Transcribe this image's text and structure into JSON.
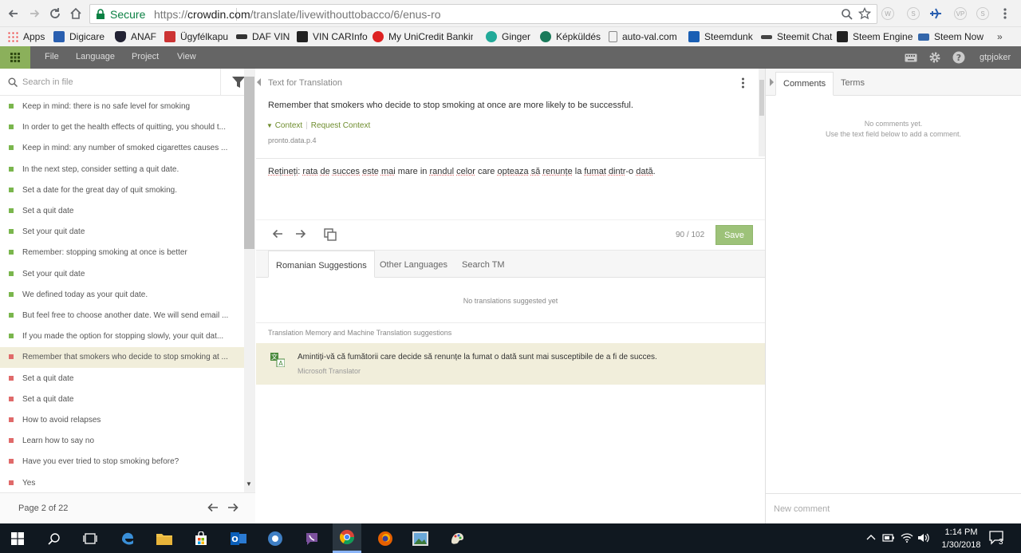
{
  "browser": {
    "secure_label": "Secure",
    "url_scheme": "https://",
    "url_domain": "crowdin.com",
    "url_path": "/translate/livewithouttobacco/6/enus-ro",
    "extensions": [
      "W",
      "S",
      "VP",
      "S"
    ]
  },
  "bookmarks": [
    {
      "label": "Apps",
      "color": "#e44"
    },
    {
      "label": "Digicare",
      "color": "#2a5fb0"
    },
    {
      "label": "ANAF",
      "color": "#223"
    },
    {
      "label": "Ügyfélkapu",
      "color": "#c33"
    },
    {
      "label": "DAF VIN",
      "color": "#333"
    },
    {
      "label": "VIN CARInfo",
      "color": "#222"
    },
    {
      "label": "My UniCredit Banking",
      "color": "#d22"
    },
    {
      "label": "Ginger",
      "color": "#2a9"
    },
    {
      "label": "Képküldés",
      "color": "#1a7a5a"
    },
    {
      "label": "auto-val.com",
      "color": "#888"
    },
    {
      "label": "Steemdunk",
      "color": "#1a5fb4"
    },
    {
      "label": "Steemit Chat",
      "color": "#444"
    },
    {
      "label": "Steem Engine",
      "color": "#222"
    },
    {
      "label": "Steem Now",
      "color": "#3366aa"
    }
  ],
  "bookmarks_more": "»",
  "appbar": {
    "menu": [
      "File",
      "Language",
      "Project",
      "View"
    ],
    "user": "gtpjoker"
  },
  "left": {
    "search_placeholder": "Search in file",
    "strings": [
      {
        "text": "Keep in mind: there is no safe level for smoking",
        "status": "translated"
      },
      {
        "text": "In order to get the health effects of quitting, you should t...",
        "status": "translated"
      },
      {
        "text": "Keep in mind: any number of smoked cigarettes causes ...",
        "status": "translated"
      },
      {
        "text": "In the next step, consider setting a quit date.",
        "status": "translated"
      },
      {
        "text": "Set a date for the great day of quit smoking.",
        "status": "translated"
      },
      {
        "text": "Set a quit date",
        "status": "translated"
      },
      {
        "text": "Set your quit date",
        "status": "translated"
      },
      {
        "text": "Remember: stopping smoking at once is better",
        "status": "translated"
      },
      {
        "text": "Set your quit date",
        "status": "translated"
      },
      {
        "text": "We defined today as your quit date.",
        "status": "translated"
      },
      {
        "text": "But feel free to choose another date. We will send email ...",
        "status": "translated"
      },
      {
        "text": "If you made the option for stopping slowly, your quit dat...",
        "status": "translated"
      },
      {
        "text": "Remember that smokers who decide to stop smoking at ...",
        "status": "untranslated",
        "active": true
      },
      {
        "text": "Set a quit date",
        "status": "untranslated"
      },
      {
        "text": "Set a quit date",
        "status": "untranslated"
      },
      {
        "text": "How to avoid relapses",
        "status": "untranslated"
      },
      {
        "text": "Learn how to say no",
        "status": "untranslated"
      },
      {
        "text": "Have you ever tried to stop smoking before?",
        "status": "untranslated"
      },
      {
        "text": "Yes",
        "status": "untranslated"
      }
    ],
    "page_label": "Page 2 of 22"
  },
  "editor": {
    "header": "Text for Translation",
    "source_text": "Remember that smokers who decide to stop smoking at once are more likely to be successful.",
    "context_label": "Context",
    "request_context_label": "Request Context",
    "string_key": "pronto.data.p.4",
    "translation_parts": [
      {
        "t": "Rețineți",
        "sp": true
      },
      {
        "t": ": ",
        "sp": false
      },
      {
        "t": "rata",
        "sp": true
      },
      {
        "t": " ",
        "sp": false
      },
      {
        "t": "de",
        "sp": true
      },
      {
        "t": " ",
        "sp": false
      },
      {
        "t": "succes",
        "sp": true
      },
      {
        "t": " ",
        "sp": false
      },
      {
        "t": "este",
        "sp": true
      },
      {
        "t": " ",
        "sp": false
      },
      {
        "t": "mai",
        "sp": true
      },
      {
        "t": " mare in ",
        "sp": false
      },
      {
        "t": "randul",
        "sp": true
      },
      {
        "t": " ",
        "sp": false
      },
      {
        "t": "celor",
        "sp": true
      },
      {
        "t": " care ",
        "sp": false
      },
      {
        "t": "opteaza",
        "sp": true
      },
      {
        "t": " ",
        "sp": false
      },
      {
        "t": "să",
        "sp": true
      },
      {
        "t": " ",
        "sp": false
      },
      {
        "t": "renunțe",
        "sp": true
      },
      {
        "t": " la ",
        "sp": false
      },
      {
        "t": "fumat",
        "sp": true
      },
      {
        "t": " ",
        "sp": false
      },
      {
        "t": "dintr",
        "sp": true
      },
      {
        "t": "-o ",
        "sp": false
      },
      {
        "t": "dată",
        "sp": true
      },
      {
        "t": ".",
        "sp": false
      }
    ],
    "counter": "90 / 102",
    "save_label": "Save"
  },
  "suggestions": {
    "tabs": [
      "Romanian Suggestions",
      "Other Languages",
      "Search TM"
    ],
    "empty_text": "No translations suggested yet",
    "tm_header": "Translation Memory and Machine Translation suggestions",
    "mt_text": "Amintiți-vă că fumătorii care decide să renunțe la fumat o dată sunt mai susceptibile de a fi de succes.",
    "mt_source": "Microsoft Translator"
  },
  "right": {
    "tabs": [
      "Comments",
      "Terms"
    ],
    "empty_line1": "No comments yet.",
    "empty_line2": "Use the text field below to add a comment.",
    "comment_placeholder": "New comment"
  },
  "taskbar": {
    "time": "1:14 PM",
    "date": "1/30/2018",
    "notifications": "3"
  },
  "colors": {
    "accent": "#8bb05b",
    "translated": "#7ab64d",
    "untranslated": "#e06a6a",
    "active_row": "#f1eedb",
    "save": "#9dc279"
  }
}
